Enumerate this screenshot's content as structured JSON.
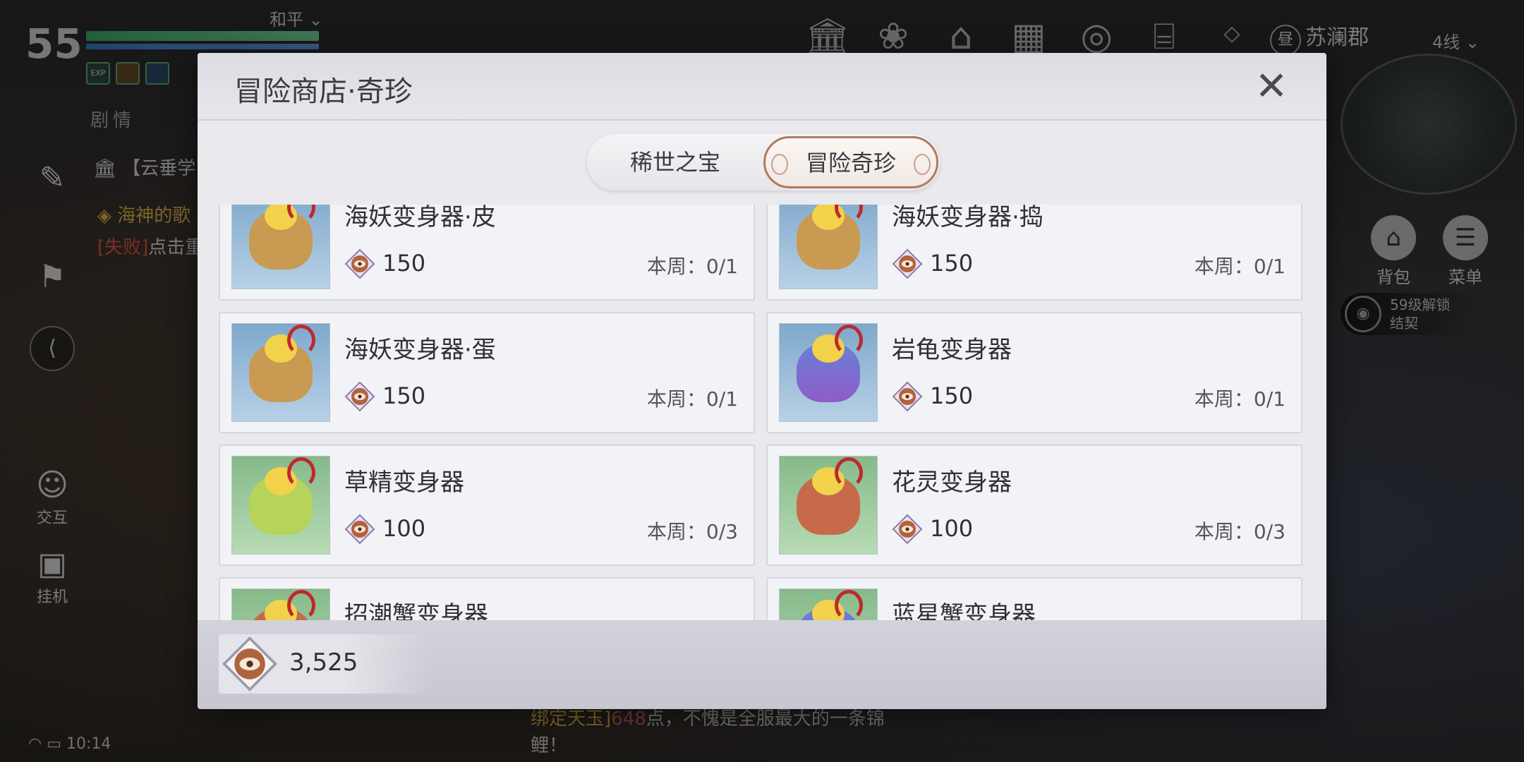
{
  "hud": {
    "level": "55",
    "server": "和平",
    "buff_exp": "EXP",
    "tabs": "剧情",
    "quest_main": "【云垂学",
    "quest_sub": "海神的歌",
    "quest_fail_tag": "[失败]",
    "quest_fail_text": "点击重",
    "interact_label": "交互",
    "auto_label": "挂机",
    "location": "苏澜郡",
    "location_emblem": "昼",
    "line": "4线",
    "bag_label": "背包",
    "menu_label": "菜单",
    "unlock_text_1": "59级解锁",
    "unlock_text_2": "结契",
    "time": "10:14",
    "chat_highlight": "绑定天玉]",
    "chat_number": "648",
    "chat_text": "点，不愧是全服最大的一条锦鲤！"
  },
  "modal": {
    "title": "冒险商店·奇珍",
    "tabs": [
      {
        "label": "稀世之宝",
        "active": false
      },
      {
        "label": "冒险奇珍",
        "active": true
      }
    ],
    "items": [
      {
        "name": "海妖变身器·皮",
        "price": "150",
        "limit": "本周：0/1",
        "bg": "blue",
        "color": "brown"
      },
      {
        "name": "海妖变身器·捣",
        "price": "150",
        "limit": "本周：0/1",
        "bg": "blue",
        "color": "brown"
      },
      {
        "name": "海妖变身器·蛋",
        "price": "150",
        "limit": "本周：0/1",
        "bg": "blue",
        "color": "brown"
      },
      {
        "name": "岩龟变身器",
        "price": "150",
        "limit": "本周：0/1",
        "bg": "blue",
        "color": "purple"
      },
      {
        "name": "草精变身器",
        "price": "100",
        "limit": "本周：0/3",
        "bg": "green",
        "color": "leaf"
      },
      {
        "name": "花灵变身器",
        "price": "100",
        "limit": "本周：0/3",
        "bg": "green",
        "color": "red"
      },
      {
        "name": "招潮蟹变身器",
        "price": "",
        "limit": "",
        "bg": "green",
        "color": "red"
      },
      {
        "name": "蓝星蟹变身器",
        "price": "",
        "limit": "",
        "bg": "green",
        "color": "purple"
      }
    ],
    "currency_amount": "3,525"
  },
  "colors": {
    "accent_tab_border": "#b07a5e",
    "fail_red": "#e05545",
    "quest_gold": "#e5b64a"
  }
}
